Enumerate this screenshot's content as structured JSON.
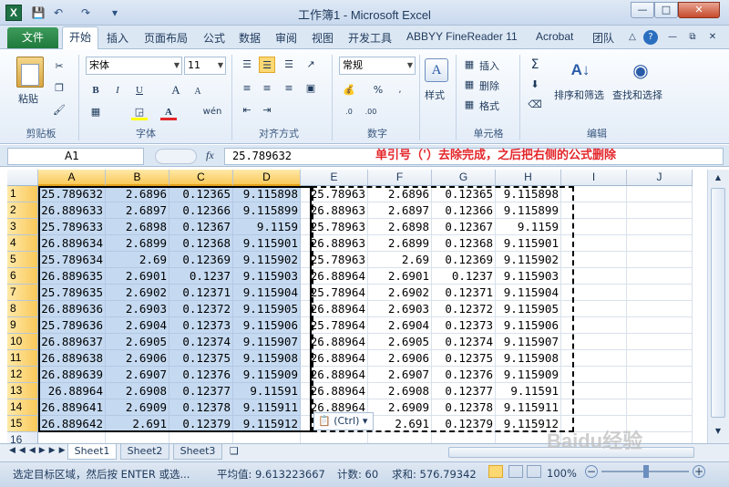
{
  "titlebar": {
    "title": "工作簿1 - Microsoft Excel",
    "app_icon": "X",
    "qat_icons": [
      "save-icon",
      "undo-icon",
      "redo-icon",
      "customize-icon"
    ]
  },
  "menu": {
    "file": "文件",
    "tabs": [
      "开始",
      "插入",
      "页面布局",
      "公式",
      "数据",
      "审阅",
      "视图",
      "开发工具",
      "ABBYY FineReader 11",
      "Acrobat",
      "团队"
    ]
  },
  "ribbon": {
    "clipboard": {
      "paste": "粘贴",
      "label": "剪贴板"
    },
    "font": {
      "name": "宋体",
      "size": "11",
      "label": "字体",
      "bold": "B",
      "italic": "I",
      "underline": "U",
      "grow": "A",
      "shrink": "A",
      "phonetic": "wén"
    },
    "alignment": {
      "label": "对齐方式"
    },
    "number": {
      "format": "常规",
      "label": "数字",
      "percent": "%"
    },
    "styles": {
      "button": "样式"
    },
    "cells": {
      "insert": "插入",
      "delete": "删除",
      "format": "格式",
      "label": "单元格"
    },
    "editing": {
      "sigma": "Σ",
      "sort": "排序和筛选",
      "find": "查找和选择",
      "label": "编辑"
    }
  },
  "formula_bar": {
    "name_box": "A1",
    "fx": "fx",
    "value": "25.789632"
  },
  "annotation": "单引号（'）去除完成，之后把右侧的公式删除",
  "grid": {
    "columns": [
      "A",
      "B",
      "C",
      "D",
      "E",
      "F",
      "G",
      "H",
      "I",
      "J"
    ],
    "rows": [
      [
        "25.789632",
        "2.6896",
        "0.12365",
        "9.115898",
        "25.78963",
        "2.6896",
        "0.12365",
        "9.115898",
        "",
        ""
      ],
      [
        "26.889633",
        "2.6897",
        "0.12366",
        "9.115899",
        "26.88963",
        "2.6897",
        "0.12366",
        "9.115899",
        "",
        ""
      ],
      [
        "25.789633",
        "2.6898",
        "0.12367",
        "9.1159",
        "25.78963",
        "2.6898",
        "0.12367",
        "9.1159",
        "",
        ""
      ],
      [
        "26.889634",
        "2.6899",
        "0.12368",
        "9.115901",
        "26.88963",
        "2.6899",
        "0.12368",
        "9.115901",
        "",
        ""
      ],
      [
        "25.789634",
        "2.69",
        "0.12369",
        "9.115902",
        "25.78963",
        "2.69",
        "0.12369",
        "9.115902",
        "",
        ""
      ],
      [
        "26.889635",
        "2.6901",
        "0.1237",
        "9.115903",
        "26.88964",
        "2.6901",
        "0.1237",
        "9.115903",
        "",
        ""
      ],
      [
        "25.789635",
        "2.6902",
        "0.12371",
        "9.115904",
        "25.78964",
        "2.6902",
        "0.12371",
        "9.115904",
        "",
        ""
      ],
      [
        "26.889636",
        "2.6903",
        "0.12372",
        "9.115905",
        "26.88964",
        "2.6903",
        "0.12372",
        "9.115905",
        "",
        ""
      ],
      [
        "25.789636",
        "2.6904",
        "0.12373",
        "9.115906",
        "25.78964",
        "2.6904",
        "0.12373",
        "9.115906",
        "",
        ""
      ],
      [
        "26.889637",
        "2.6905",
        "0.12374",
        "9.115907",
        "26.88964",
        "2.6905",
        "0.12374",
        "9.115907",
        "",
        ""
      ],
      [
        "26.889638",
        "2.6906",
        "0.12375",
        "9.115908",
        "26.88964",
        "2.6906",
        "0.12375",
        "9.115908",
        "",
        ""
      ],
      [
        "26.889639",
        "2.6907",
        "0.12376",
        "9.115909",
        "26.88964",
        "2.6907",
        "0.12376",
        "9.115909",
        "",
        ""
      ],
      [
        "26.88964",
        "2.6908",
        "0.12377",
        "9.11591",
        "26.88964",
        "2.6908",
        "0.12377",
        "9.11591",
        "",
        ""
      ],
      [
        "26.889641",
        "2.6909",
        "0.12378",
        "9.115911",
        "26.88964",
        "2.6909",
        "0.12378",
        "9.115911",
        "",
        ""
      ],
      [
        "26.889642",
        "2.691",
        "0.12379",
        "9.115912",
        "",
        "2.691",
        "0.12379",
        "9.115912",
        "",
        ""
      ],
      [
        "",
        "",
        "",
        "",
        "",
        "",
        "",
        "",
        "",
        ""
      ]
    ],
    "paste_options": "(Ctrl)"
  },
  "sheets": [
    "Sheet1",
    "Sheet2",
    "Sheet3"
  ],
  "status": {
    "message": "选定目标区域，然后按 ENTER 或选...",
    "average": "平均值: 9.613223667",
    "count": "计数: 60",
    "sum": "求和: 576.79342",
    "zoom": "100%"
  },
  "watermark": "Baidu经验",
  "colors": {
    "annotation": "#e3262b",
    "file_tab": "#1f7a3c",
    "selection": "#c5daf1",
    "header_selected": "#f9c95a"
  }
}
